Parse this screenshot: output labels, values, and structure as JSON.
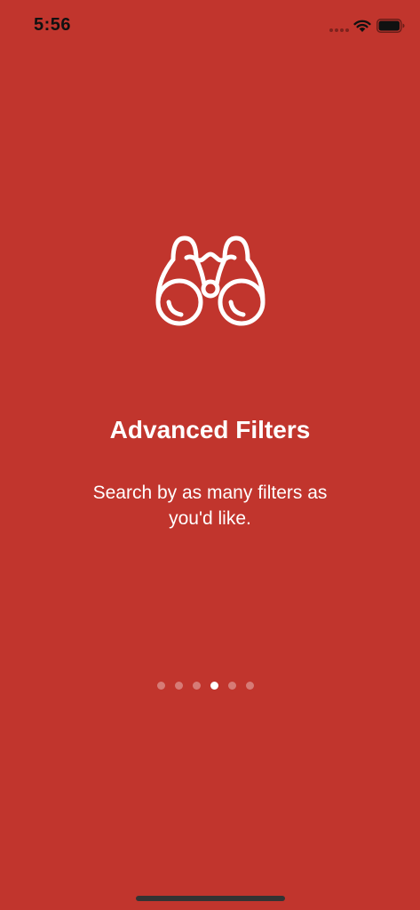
{
  "status_bar": {
    "time": "5:56"
  },
  "onboarding": {
    "icon": "binoculars-icon",
    "title": "Advanced Filters",
    "subtitle": "Search by as many filters as you'd like."
  },
  "page_indicator": {
    "total": 6,
    "current": 4
  },
  "colors": {
    "background": "#c1352d",
    "text": "#ffffff"
  }
}
